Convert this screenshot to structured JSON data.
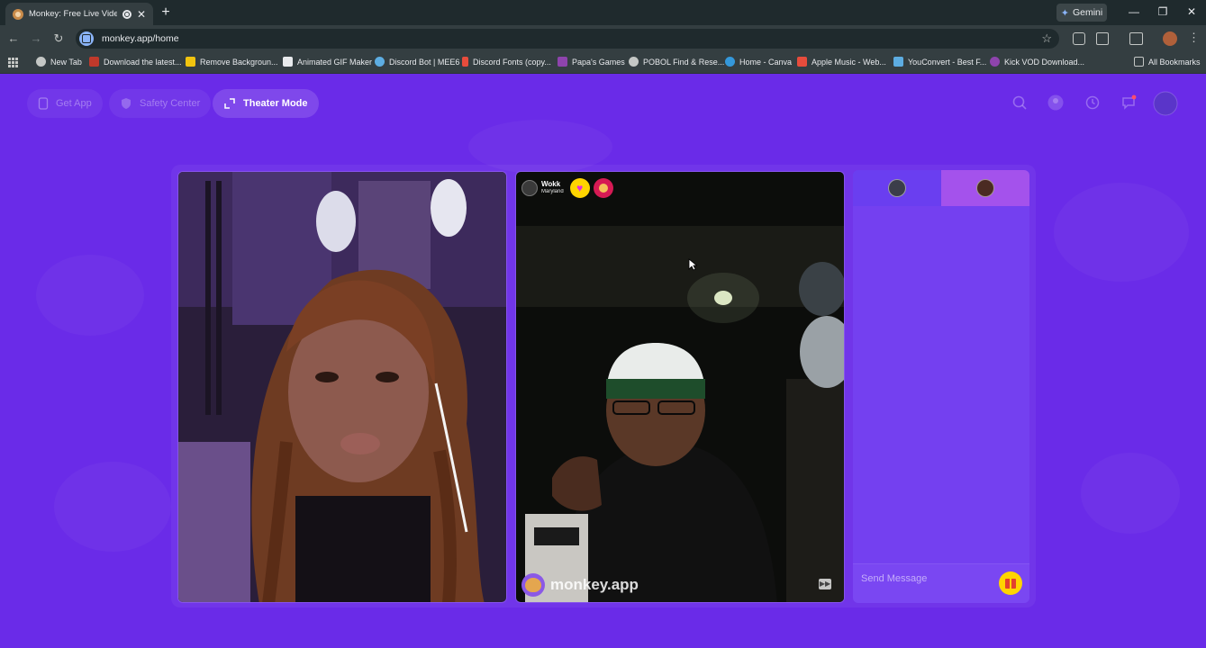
{
  "browser": {
    "tab_title": "Monkey: Free Live Video Ch",
    "new_tab_glyph": "+",
    "gemini_label": "Gemini",
    "url": "monkey.app/home",
    "bookmarks": [
      {
        "label": "New Tab",
        "color": "#c4c7c5"
      },
      {
        "label": "Download the latest...",
        "color": "#c0392b"
      },
      {
        "label": "Remove Backgroun...",
        "color": "#f1c40f"
      },
      {
        "label": "Animated GIF Maker",
        "color": "#e8eaed"
      },
      {
        "label": "Discord Bot | MEE6",
        "color": "#5dade2"
      },
      {
        "label": "Discord Fonts (copy...",
        "color": "#e74c3c"
      },
      {
        "label": "Papa's Games",
        "color": "#8e44ad"
      },
      {
        "label": "POBOL Find & Rese...",
        "color": "#c4c7c5"
      },
      {
        "label": "Home - Canva",
        "color": "#3498db"
      },
      {
        "label": "Apple Music - Web...",
        "color": "#e74c3c"
      },
      {
        "label": "YouConvert - Best F...",
        "color": "#5dade2"
      },
      {
        "label": "Kick VOD Download...",
        "color": "#8e44ad"
      }
    ],
    "all_bookmarks_label": "All Bookmarks"
  },
  "app": {
    "nav": {
      "get_app": "Get App",
      "safety_center": "Safety Center",
      "theater_mode": "Theater Mode"
    },
    "remote_user": {
      "name": "Wokk",
      "location": "Maryland"
    },
    "watermark": "monkey.app",
    "chat": {
      "placeholder": "Send Message"
    },
    "colors": {
      "background": "#6a2be8",
      "gift_button": "#ffd400"
    }
  }
}
